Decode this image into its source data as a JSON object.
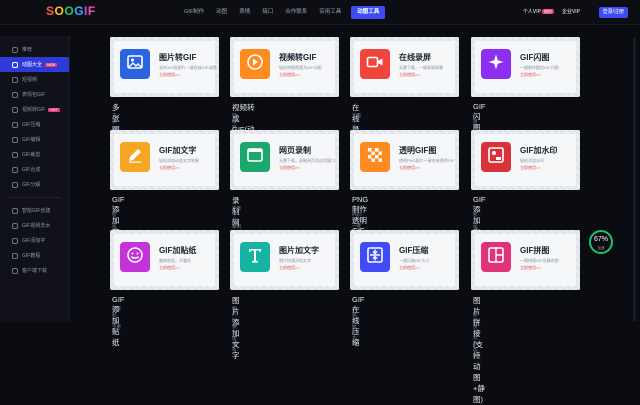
{
  "logo": {
    "text": "SOOGIF"
  },
  "nav": {
    "items": [
      "GIF制作",
      "动图",
      "表情",
      "接口",
      "合作联系",
      "实用工具"
    ],
    "active": "动图工具"
  },
  "header_right": {
    "vip_label": "个人VIP",
    "vip_badge": "限时",
    "enterprise_vip": "企业VIP",
    "login": "登录/注册"
  },
  "sidebar": {
    "items": [
      {
        "label": "推荐",
        "active": false
      },
      {
        "label": "动图大全",
        "active": true,
        "badge": "NEW"
      },
      {
        "label": "短视频",
        "active": false
      },
      {
        "label": "表情包GIF",
        "active": false
      },
      {
        "label": "视频转GIF",
        "active": false,
        "badge": "HOT"
      },
      {
        "label": "GIF压缩",
        "active": false
      },
      {
        "label": "GIF编辑",
        "active": false
      },
      {
        "label": "GIF裁剪",
        "active": false
      },
      {
        "label": "GIF合成",
        "active": false
      },
      {
        "label": "GIF分解",
        "active": false
      },
      {
        "label": "智能GIF创建",
        "active": false
      },
      {
        "label": "GIF视频去水",
        "active": false
      },
      {
        "label": "GIF添加字",
        "active": false
      },
      {
        "label": "GIF教程",
        "active": false
      },
      {
        "label": "客户端下载",
        "active": false
      }
    ]
  },
  "tools": [
    {
      "title": "图片转GIF",
      "name": "多张图片合成GIF",
      "desc": "支持100张图片一键合成GIF动图",
      "color": "#2b63e0",
      "icon": "image-icon"
    },
    {
      "title": "视频转GIF",
      "name": "视频转成GIF(动图)",
      "desc": "轻松转换视频为GIF动图",
      "color": "#ff8a1f",
      "icon": "play-icon"
    },
    {
      "title": "在线录屏",
      "name": "在线录制屏幕",
      "desc": "无需下载，一键录制屏幕",
      "color": "#f0453d",
      "icon": "camera-icon"
    },
    {
      "title": "GIF闪图",
      "name": "GIF闪图制作",
      "desc": "一键制作酷炫GIF闪图",
      "color": "#8c2ff0",
      "icon": "sparkle-icon"
    },
    {
      "title": "GIF加文字",
      "name": "GIF添加文字动效",
      "desc": "轻松添加动态文字效果",
      "color": "#f5a623",
      "icon": "pencil-icon"
    },
    {
      "title": "网页录制",
      "name": "录制网页应用窗口",
      "desc": "无需下载，录制网页及应用窗口",
      "color": "#1aa86c",
      "icon": "window-icon"
    },
    {
      "title": "透明GIF图",
      "name": "PNG制作透明GIF",
      "desc": "透明PNG图片一键合成透明GIF",
      "color": "#ff8a1f",
      "icon": "checker-icon"
    },
    {
      "title": "GIF加水印",
      "name": "GIF添加水印",
      "desc": "轻松添加水印",
      "color": "#d8323a",
      "icon": "watermark-icon"
    },
    {
      "title": "GIF加贴纸",
      "name": "GIF添加贴纸",
      "desc": "趣味贴纸，不重样",
      "color": "#c432d8",
      "icon": "smile-icon"
    },
    {
      "title": "图片加文字",
      "name": "图片添加文字",
      "desc": "图片快速添加文字",
      "color": "#17b4a3",
      "icon": "text-t-icon"
    },
    {
      "title": "GIF压缩",
      "name": "GIF在线压缩",
      "desc": "一键压缩GIF大小",
      "color": "#3f4cf6",
      "icon": "compress-icon"
    },
    {
      "title": "GIF拼图",
      "name": "图片拼接(支持动图+静图)",
      "desc": "一键拼接GIF及静态图",
      "color": "#e0337a",
      "icon": "grid-icon"
    }
  ],
  "card_link": "立即使用>>",
  "badge": {
    "value": "67%",
    "sub": "加速"
  }
}
